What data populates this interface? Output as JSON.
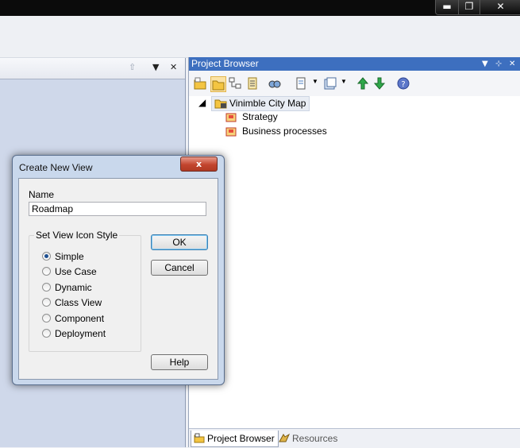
{
  "window": {
    "min_icon": "minimize-icon",
    "max_icon": "restore-icon",
    "close_icon": "close-icon"
  },
  "project_browser": {
    "title": "Project Browser",
    "tree": {
      "root": "Vinimble City Map",
      "children": [
        "Strategy",
        "Business processes"
      ]
    },
    "tabs": [
      {
        "label": "Project Browser",
        "active": true
      },
      {
        "label": "Resources",
        "active": false
      }
    ]
  },
  "dialog": {
    "title": "Create New View",
    "close_label": "x",
    "name_label": "Name",
    "name_value": "Roadmap",
    "group_label": "Set View Icon Style",
    "options": [
      "Simple",
      "Use Case",
      "Dynamic",
      "Class View",
      "Component",
      "Deployment"
    ],
    "selected": "Simple",
    "ok": "OK",
    "cancel": "Cancel",
    "help": "Help"
  },
  "colors": {
    "title_blue": "#3d6fbf",
    "pane_bg": "#cfd8ea",
    "dialog_frame": "#c9d8ec"
  }
}
